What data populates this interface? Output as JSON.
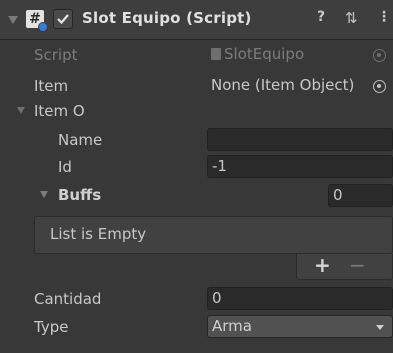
{
  "header": {
    "title": "Slot Equipo (Script)",
    "icons": [
      "foldout-arrow-icon",
      "script-component-icon",
      "enabled-checkbox",
      "help-icon",
      "presets-icon",
      "kebab-menu-icon"
    ],
    "help_glyph": "?",
    "presets_glyph": "⇅",
    "menu_glyph": "⋮"
  },
  "fields": {
    "script": {
      "label": "Script",
      "value": "SlotEquipo"
    },
    "item": {
      "label": "Item",
      "value": "None (Item Object)"
    },
    "item_o": {
      "label": "Item O"
    },
    "name": {
      "label": "Name",
      "value": ""
    },
    "id": {
      "label": "Id",
      "value": "-1"
    },
    "buffs": {
      "label": "Buffs",
      "size": "0",
      "empty_text": "List is Empty",
      "add_glyph": "+",
      "remove_glyph": "−"
    },
    "cantidad": {
      "label": "Cantidad",
      "value": "0"
    },
    "type": {
      "label": "Type",
      "value": "Arma"
    }
  }
}
